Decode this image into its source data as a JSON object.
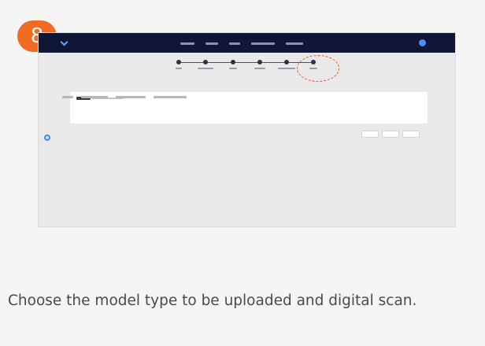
{
  "step_number": "8",
  "caption": "Choose the model type to be uploaded and digital scan.",
  "colors": {
    "badge": "#f06a22",
    "topbar": "#0f1636",
    "highlight": "#e85a2a"
  },
  "icons": {
    "app_logo": "app-logo-icon",
    "avatar": "user-avatar-icon",
    "side": "circle-icon"
  }
}
